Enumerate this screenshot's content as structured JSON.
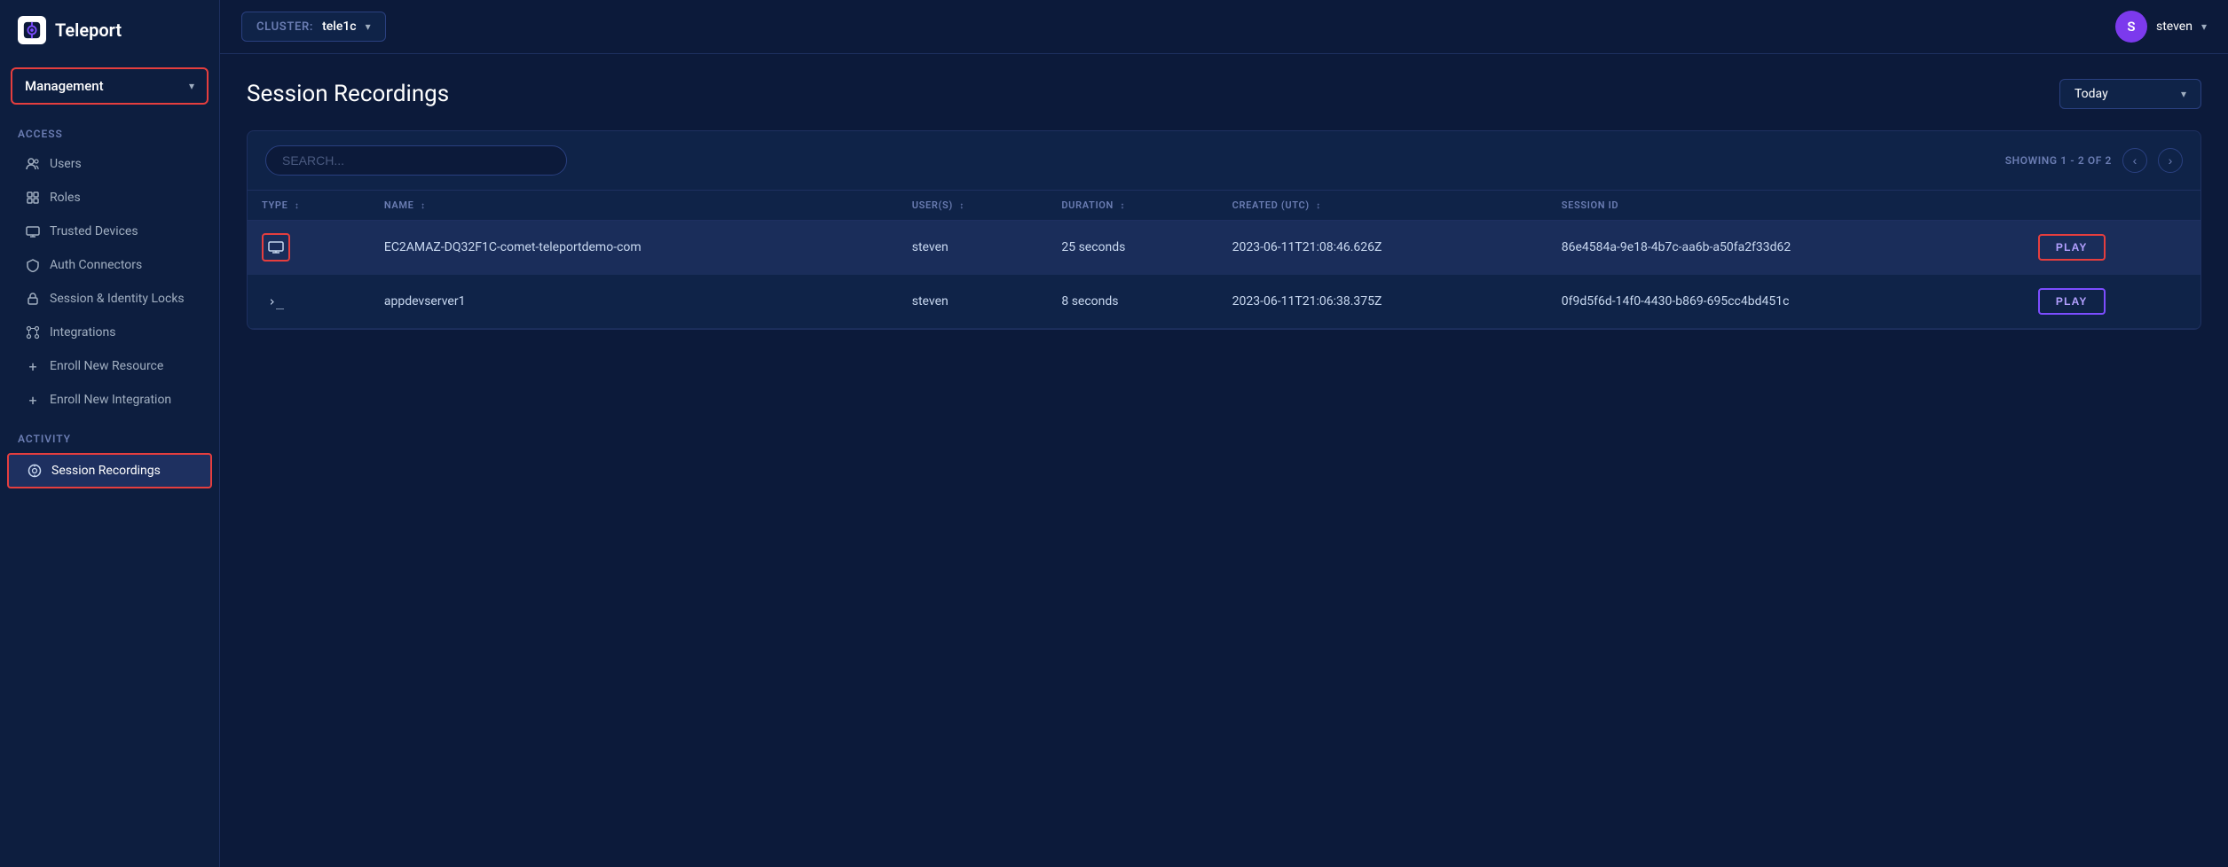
{
  "app": {
    "logo_text": "Teleport"
  },
  "sidebar": {
    "management_label": "Management",
    "access_section": "Access",
    "activity_section": "Activity",
    "items": [
      {
        "id": "users",
        "label": "Users",
        "icon": "users-icon"
      },
      {
        "id": "roles",
        "label": "Roles",
        "icon": "roles-icon"
      },
      {
        "id": "trusted-devices",
        "label": "Trusted Devices",
        "icon": "device-icon"
      },
      {
        "id": "auth-connectors",
        "label": "Auth Connectors",
        "icon": "shield-icon"
      },
      {
        "id": "session-identity-locks",
        "label": "Session & Identity Locks",
        "icon": "lock-icon"
      },
      {
        "id": "integrations",
        "label": "Integrations",
        "icon": "integrations-icon"
      },
      {
        "id": "enroll-resource",
        "label": "Enroll New Resource",
        "icon": "plus-icon"
      },
      {
        "id": "enroll-integration",
        "label": "Enroll New Integration",
        "icon": "plus-icon"
      }
    ],
    "activity_items": [
      {
        "id": "session-recordings",
        "label": "Session Recordings",
        "icon": "recordings-icon",
        "active": true
      }
    ]
  },
  "topbar": {
    "cluster_label": "CLUSTER:",
    "cluster_name": "tele1c",
    "user_initial": "S",
    "user_name": "steven",
    "chevron": "▾"
  },
  "page": {
    "title": "Session Recordings",
    "date_filter": "Today"
  },
  "table": {
    "search_placeholder": "SEARCH...",
    "pagination_text": "SHOWING 1 - 2 OF 2",
    "columns": [
      {
        "id": "type",
        "label": "TYPE"
      },
      {
        "id": "name",
        "label": "NAME"
      },
      {
        "id": "users",
        "label": "USER(S)"
      },
      {
        "id": "duration",
        "label": "DURATION"
      },
      {
        "id": "created",
        "label": "CREATED (UTC)"
      },
      {
        "id": "session-id",
        "label": "SESSION ID"
      },
      {
        "id": "action",
        "label": ""
      }
    ],
    "rows": [
      {
        "type": "desktop",
        "name": "EC2AMAZ-DQ32F1C-comet-teleportdemo-com",
        "users": "steven",
        "duration": "25 seconds",
        "created": "2023-06-11T21:08:46.626Z",
        "session_id": "86e4584a-9e18-4b7c-aa6b-a50fa2f33d62",
        "play_label": "PLAY",
        "highlighted": true
      },
      {
        "type": "terminal",
        "name": "appdevserver1",
        "users": "steven",
        "duration": "8 seconds",
        "created": "2023-06-11T21:06:38.375Z",
        "session_id": "0f9d5f6d-14f0-4430-b869-695cc4bd451c",
        "play_label": "PLAY",
        "highlighted": false
      }
    ]
  },
  "colors": {
    "accent_red": "#e53e3e",
    "accent_purple": "#7c4dff",
    "sidebar_bg": "#0d1e3f",
    "main_bg": "#0c1a3a",
    "table_bg": "#0f2348"
  }
}
